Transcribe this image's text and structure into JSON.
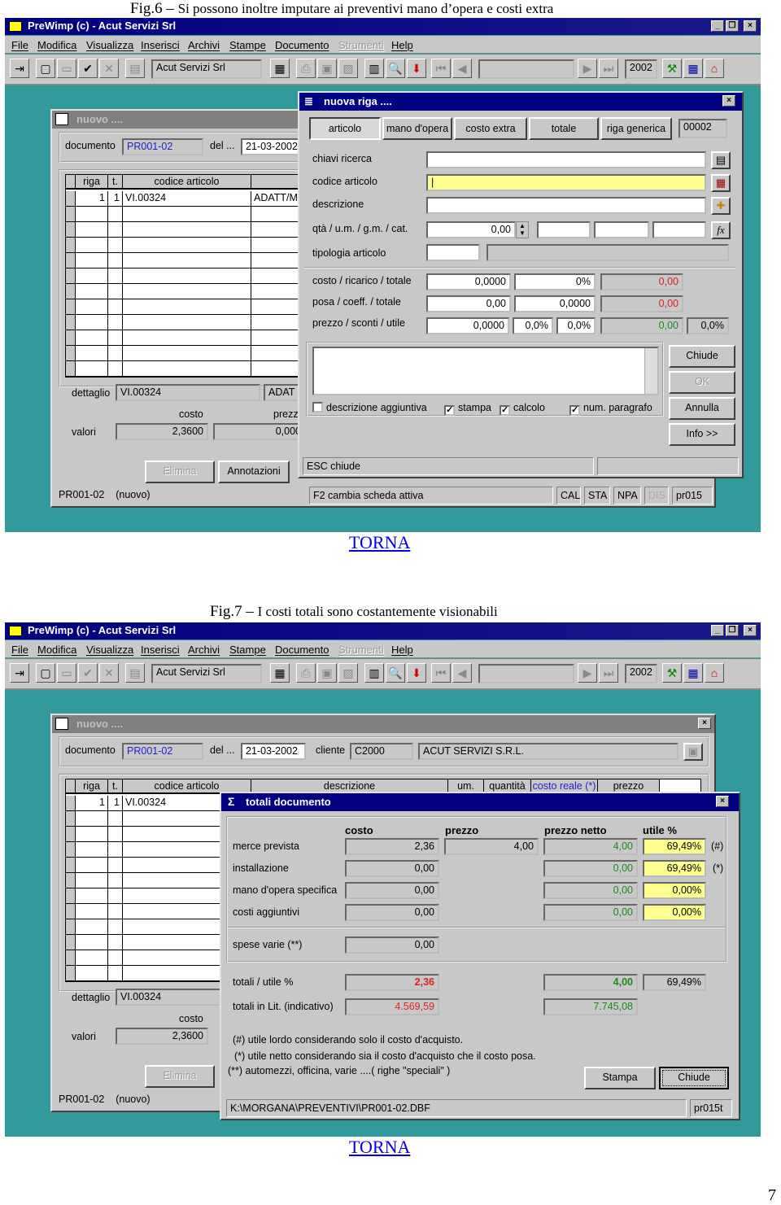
{
  "fig6": {
    "caption_num": "Fig.6",
    "caption_dash": " – ",
    "caption_text": "Si possono inoltre imputare ai preventivi mano d’opera e costi extra"
  },
  "fig7": {
    "caption_num": "Fig.7",
    "caption_dash": " – ",
    "caption_text": "I costi totali sono costantemente visionabili"
  },
  "back_link": "TORNA",
  "page_number": "7",
  "app": {
    "title": "PreWimp (c)  - Acut Servizi Srl",
    "menu": [
      "File",
      "Modifica",
      "Visualizza",
      "Inserisci",
      "Archivi",
      "Stampe",
      "Documento",
      "Strumenti",
      "Help"
    ],
    "company": "Acut Servizi Srl",
    "year": "2002",
    "background_color": "#329a9a",
    "titlebar_color": "#000080"
  },
  "doc_window": {
    "title": "nuovo ....",
    "documento_label": "documento",
    "documento_value": "PR001-02",
    "del_label": "del ...",
    "date": "21-03-2002",
    "cliente_label": "cliente",
    "cliente_code": "C2000",
    "cliente_name": "ACUT SERVIZI S.R.L.",
    "columns": [
      "riga",
      "t.",
      "codice articolo",
      "descrizione",
      "um.",
      "quantità",
      "costo reale (*)",
      "prezzo"
    ],
    "row": {
      "riga": "1",
      "t": "1",
      "codice": "VI.00324",
      "descrizione": "ADATT/M"
    },
    "dettaglio_label": "dettaglio",
    "dettaglio_code": "VI.00324",
    "dettaglio_desc": "ADAT",
    "costo_label": "costo",
    "prezzo_label": "prezz",
    "valori_label": "valori",
    "valori_costo": "2,3600",
    "valori_prezzo": "0,000",
    "elimina": "Elimina",
    "annotazioni": "Annotazioni",
    "status_doc": "PR001-02",
    "status_state": "(nuovo)",
    "status_hint": "F2 cambia scheda attiva",
    "status_flags": [
      "CAL",
      "STA",
      "NPA",
      "DIS"
    ],
    "status_code": "pr015"
  },
  "nuova_riga": {
    "title": "nuova riga ....",
    "tabs": [
      "articolo",
      "mano d'opera",
      "costo extra",
      "totale",
      "riga generica"
    ],
    "counter": "00002",
    "labels": [
      "chiavi ricerca",
      "codice articolo",
      "descrizione",
      "qtà / u.m. / g.m. / cat.",
      "tipologia articolo",
      "costo / ricarico / totale",
      "posa / coeff. / totale",
      "prezzo / sconti / utile"
    ],
    "qta": "0,00",
    "costo": [
      "0,0000",
      "0%",
      "0,00"
    ],
    "posa": [
      "0,00",
      "0,0000",
      "0,00"
    ],
    "prezzo": [
      "0,0000",
      "0,0%",
      "0,0%",
      "0,00",
      "0,0%"
    ],
    "checkboxes": [
      {
        "label": "descrizione aggiuntiva",
        "checked": false
      },
      {
        "label": "stampa",
        "checked": true
      },
      {
        "label": "calcolo",
        "checked": true
      },
      {
        "label": "num. paragrafo",
        "checked": true
      }
    ],
    "buttons": {
      "chiude": "Chiude",
      "ok": "OK",
      "annulla": "Annulla",
      "info": "Info >>"
    },
    "status": "ESC chiude"
  },
  "totali": {
    "title": "totali documento",
    "headers": [
      "costo",
      "prezzo",
      "prezzo netto",
      "utile %"
    ],
    "rows": [
      {
        "label": "merce prevista",
        "costo": "2,36",
        "prezzo": "4,00",
        "netto": "4,00",
        "utile": "69,49%",
        "mark": "(#)"
      },
      {
        "label": "installazione",
        "costo": "0,00",
        "netto": "0,00",
        "utile": "69,49%",
        "mark": "(*)"
      },
      {
        "label": "mano d'opera specifica",
        "costo": "0,00",
        "netto": "0,00",
        "utile": "0,00%"
      },
      {
        "label": "costi aggiuntivi",
        "costo": "0,00",
        "netto": "0,00",
        "utile": "0,00%"
      }
    ],
    "spese_label": "spese varie (**)",
    "spese_value": "0,00",
    "totali_label": "totali / utile %",
    "totali_costo": "2,36",
    "totali_netto": "4,00",
    "totali_utile": "69,49%",
    "lit_label": "totali in Lit. (indicativo)",
    "lit_costo": "4.569,59",
    "lit_netto": "7.745,08",
    "notes": [
      "(#) utile lordo considerando solo il costo d'acquisto.",
      "(*) utile netto considerando sia il costo d'acquisto che il costo posa.",
      "(**)  automezzi, officina, varie ....( righe \"speciali\" )"
    ],
    "stampa": "Stampa",
    "chiude": "Chiude",
    "status_path": "K:\\MORGANA\\PREVENTIVI\\PR001-02.DBF",
    "status_code": "pr015t"
  }
}
